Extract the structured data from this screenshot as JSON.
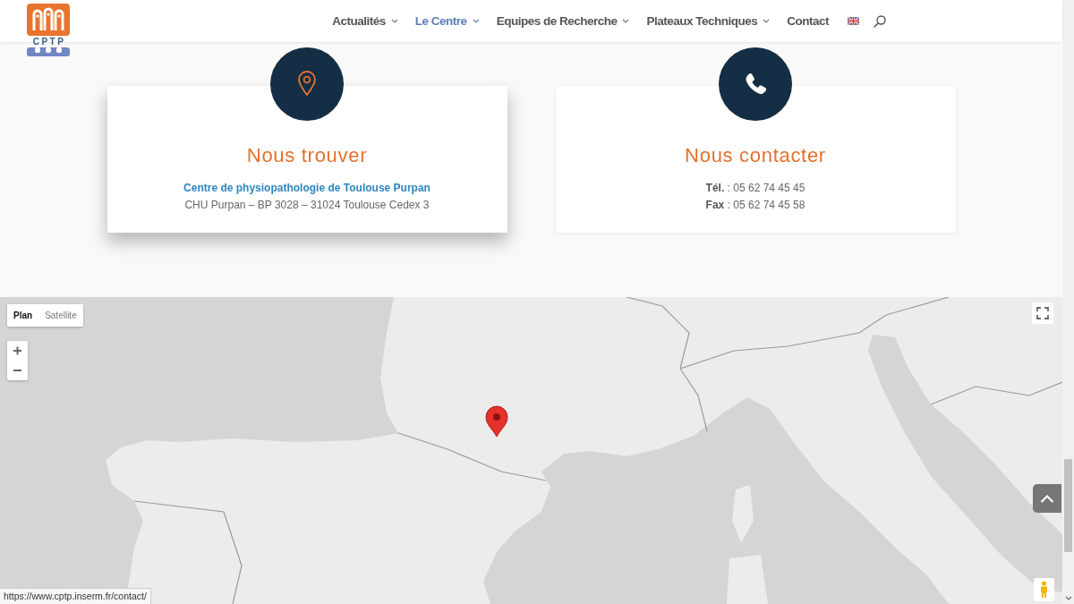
{
  "header": {
    "logo_text": "CPTP",
    "nav": [
      {
        "label": "Actualités",
        "selected": false,
        "has_menu": true
      },
      {
        "label": "Le Centre",
        "selected": true,
        "has_menu": true
      },
      {
        "label": "Equipes de Recherche",
        "selected": false,
        "has_menu": true
      },
      {
        "label": "Plateaux Techniques",
        "selected": false,
        "has_menu": true
      },
      {
        "label": "Contact",
        "selected": false,
        "has_menu": false
      }
    ]
  },
  "cards": [
    {
      "kind": "location",
      "raised": true,
      "title": "Nous trouver",
      "lines": [
        {
          "kind": "link",
          "text": "Centre de physiopathologie de Toulouse Purpan"
        },
        {
          "kind": "text",
          "text": "CHU Purpan – BP 3028 – 31024 Toulouse Cedex 3"
        }
      ]
    },
    {
      "kind": "phone",
      "raised": false,
      "title": "Nous contacter",
      "lines": [
        {
          "kind": "text",
          "text": "**Tél.** : 05 62 74 45 45"
        },
        {
          "kind": "text",
          "text": "**Fax** : 05 62 74 45 58"
        }
      ]
    }
  ],
  "map": {
    "view_tabs": [
      {
        "label": "Plan",
        "selected": true
      },
      {
        "label": "Satellite",
        "selected": false
      }
    ]
  },
  "status_url": "https://www.cptp.inserm.fr/contact/"
}
